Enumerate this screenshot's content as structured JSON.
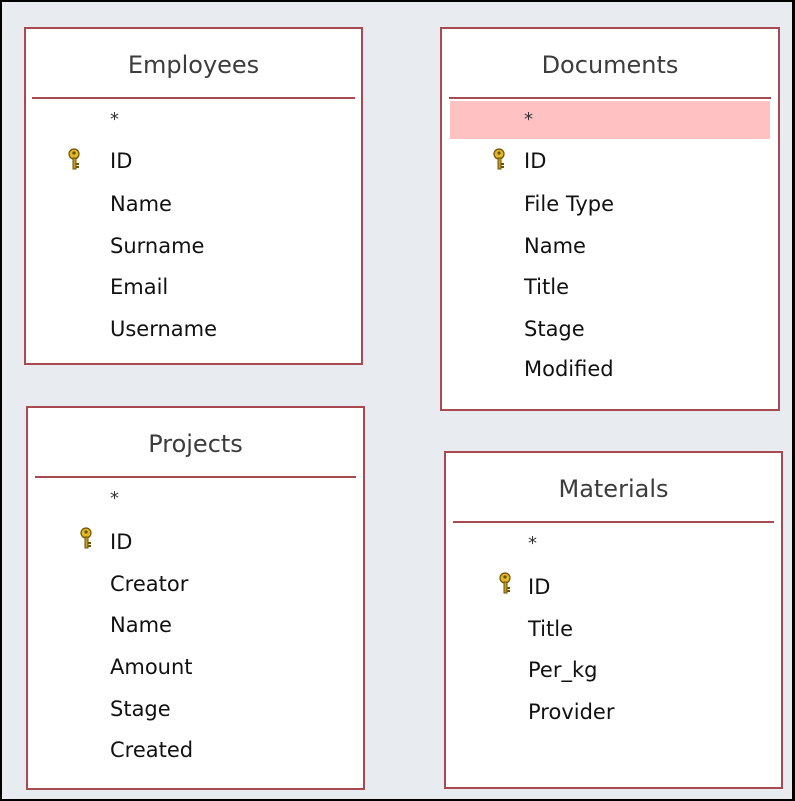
{
  "tables": {
    "employees": {
      "title": "Employees",
      "all_fields": "*",
      "fields": [
        "ID",
        "Name",
        "Surname",
        "Email",
        "Username"
      ]
    },
    "documents": {
      "title": "Documents",
      "all_fields": "*",
      "fields": [
        "ID",
        "File Type",
        "Name",
        "Title",
        "Stage",
        "Modified"
      ]
    },
    "projects": {
      "title": "Projects",
      "all_fields": "*",
      "fields": [
        "ID",
        "Creator",
        "Name",
        "Amount",
        "Stage",
        "Created"
      ]
    },
    "materials": {
      "title": "Materials",
      "all_fields": "*",
      "fields": [
        "ID",
        "Title",
        "Per_kg",
        "Provider"
      ]
    }
  },
  "colors": {
    "border": "#a84a52",
    "selection": "#ffc1c1",
    "canvas": "#e8ebef"
  },
  "icons": {
    "primary_key": "key-icon"
  }
}
